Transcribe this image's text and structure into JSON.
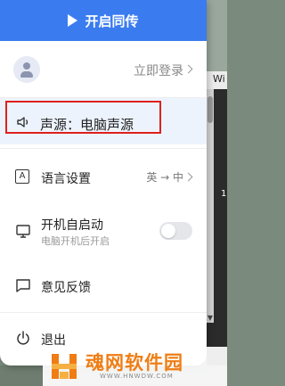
{
  "start_button": {
    "label": "开启同传",
    "icon": "play-icon"
  },
  "login": {
    "label": "立即登录",
    "icon": "avatar-icon"
  },
  "sound_source": {
    "label": "声源：电脑声源",
    "icon": "speaker-icon"
  },
  "language": {
    "label": "语言设置",
    "icon": "language-icon",
    "icon_glyph": "A",
    "value": "英 → 中"
  },
  "autostart": {
    "label": "开机自启动",
    "sublabel": "电脑开机后开启",
    "icon": "monitor-icon",
    "enabled": false
  },
  "feedback": {
    "label": "意见反馈",
    "icon": "message-icon"
  },
  "exit": {
    "label": "退出",
    "icon": "power-icon"
  },
  "background": {
    "window_label": "Wi",
    "side_number": "1"
  },
  "watermark": {
    "title": "魂网软件园",
    "url": "WWW.HNWDW.COM"
  },
  "colors": {
    "accent": "#3a7cf0",
    "highlight": "#e0201d",
    "watermark": "#ef7d14"
  }
}
